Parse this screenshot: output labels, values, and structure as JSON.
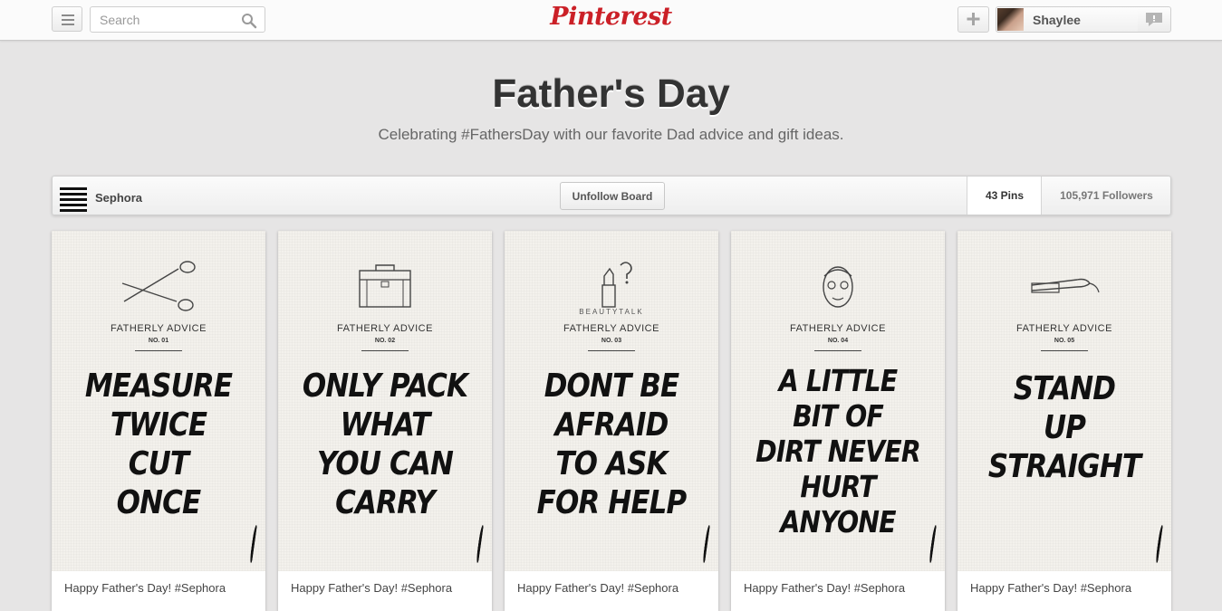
{
  "header": {
    "search_placeholder": "Search",
    "logo": "Pinterest",
    "user_name": "Shaylee",
    "brand_color": "#cb2027"
  },
  "board": {
    "title": "Father's Day",
    "description": "Celebrating #FathersDay with our favorite Dad advice and gift ideas.",
    "owner": "Sephora",
    "unfollow_label": "Unfollow Board",
    "pins_stat": "43 Pins",
    "followers_stat": "105,971 Followers"
  },
  "pins": [
    {
      "icon": "scissors-icon",
      "kicker": "",
      "advice": "FATHERLY ADVICE",
      "number": "NO. 01",
      "quote": [
        "MEASURE",
        "TWICE",
        "CUT",
        "ONCE"
      ],
      "caption": "Happy Father's Day! #Sephora"
    },
    {
      "icon": "briefcase-icon",
      "kicker": "",
      "advice": "FATHERLY ADVICE",
      "number": "NO. 02",
      "quote": [
        "ONLY PACK",
        "WHAT",
        "YOU CAN",
        "CARRY"
      ],
      "caption": "Happy Father's Day! #Sephora"
    },
    {
      "icon": "lipstick-question-icon",
      "kicker": "BEAUTYTALK",
      "advice": "FATHERLY ADVICE",
      "number": "NO. 03",
      "quote": [
        "DONT BE",
        "AFRAID",
        "TO ASK",
        "FOR HELP"
      ],
      "caption": "Happy Father's Day! #Sephora"
    },
    {
      "icon": "face-mask-icon",
      "kicker": "",
      "advice": "FATHERLY ADVICE",
      "number": "NO. 04",
      "quote": [
        "A LITTLE",
        "BIT OF",
        "DIRT NEVER",
        "HURT",
        "ANYONE"
      ],
      "caption": "Happy Father's Day! #Sephora"
    },
    {
      "icon": "flat-iron-icon",
      "kicker": "",
      "advice": "FATHERLY ADVICE",
      "number": "NO. 05",
      "quote": [
        "STAND",
        "UP",
        "STRAIGHT"
      ],
      "caption": "Happy Father's Day! #Sephora"
    }
  ]
}
